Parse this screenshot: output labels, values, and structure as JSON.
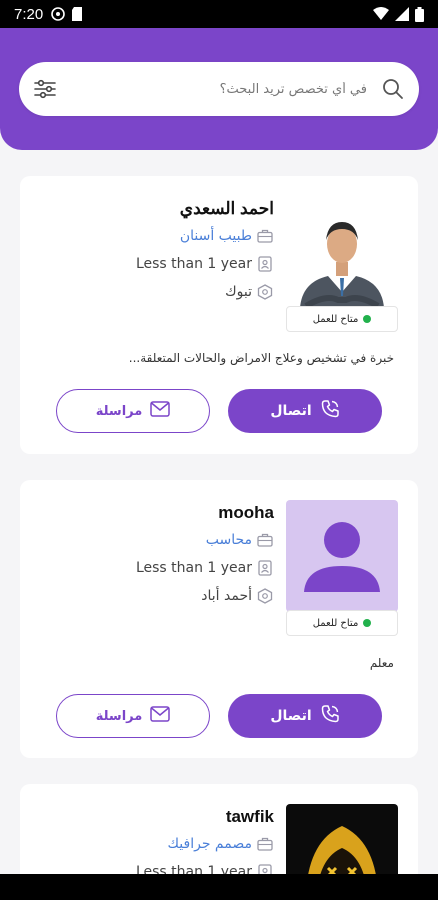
{
  "status_bar": {
    "time": "7:20"
  },
  "search": {
    "placeholder": "في أي تخصص تريد البحث؟"
  },
  "cards": [
    {
      "name": "احمد السعدي",
      "specialty": "طبيب أسنان",
      "experience": "Less than 1 year",
      "location": "تبوك",
      "availability": "متاح للعمل",
      "description": "خبرة في تشخيص وعلاج الامراض والحالات المتعلقة...",
      "call_label": "اتصال",
      "message_label": "مراسلة"
    },
    {
      "name": "mooha",
      "specialty": "محاسب",
      "experience": "Less than 1 year",
      "location": "أحمد أباد",
      "availability": "متاح للعمل",
      "description": "معلم",
      "call_label": "اتصال",
      "message_label": "مراسلة"
    },
    {
      "name": "tawfik",
      "specialty": "مصمم جرافيك",
      "experience": "Less than 1 year"
    }
  ],
  "colors": {
    "primary": "#7b45c9",
    "link": "#4a7fd8",
    "available": "#22b14c"
  }
}
